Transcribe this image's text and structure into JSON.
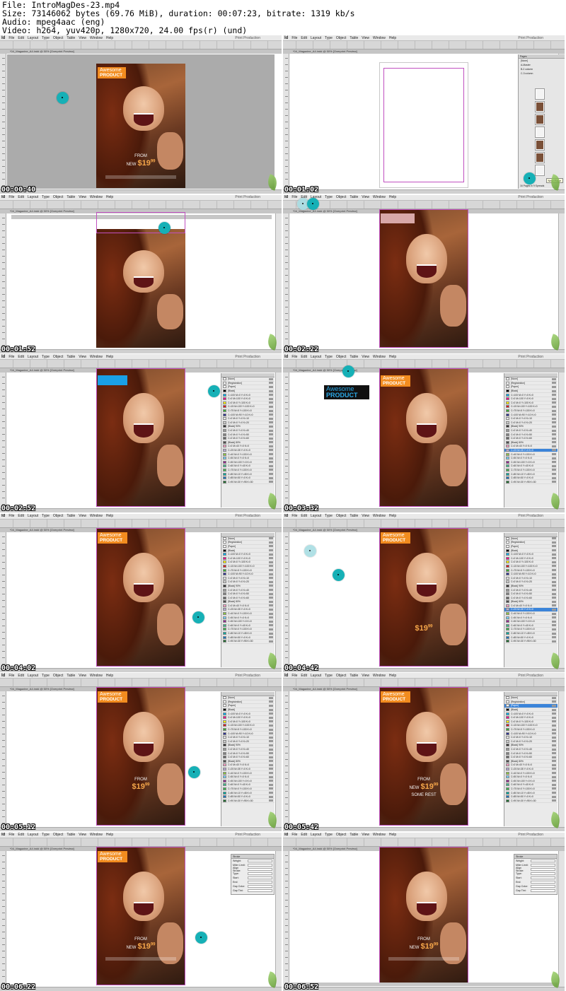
{
  "header": {
    "file_line": "File: IntroMagDes-23.mp4",
    "size_line": "Size: 73146062 bytes (69.76 MiB), duration: 00:07:23, bitrate: 1319 kb/s",
    "audio_line": "Audio: mpeg4aac (eng)",
    "video_line": "Video: h264, yuv420p, 1280x720, 24.00 fps(r) (und)"
  },
  "app": {
    "logo": "Id",
    "menus": [
      "File",
      "Edit",
      "Layout",
      "Type",
      "Object",
      "Table",
      "View",
      "Window",
      "Help"
    ],
    "workspace": "Print Production",
    "doc_tab": "*04_Magazine_A4.indd @ 50% [Overprint Preview]"
  },
  "cover": {
    "tag_line1": "Awesome",
    "tag_line2": "PRODUCT",
    "from": "FROM",
    "new": "NEW",
    "price": "$19",
    "cents": "99",
    "some_rest": "SOME REST"
  },
  "swatches": [
    "[None]",
    "[Registration]",
    "[Paper]",
    "[Black]",
    "C=100 M=0 Y=0 K=0",
    "C=0 M=100 Y=0 K=0",
    "C=0 M=0 Y=100 K=0",
    "C=15 M=100 Y=100 K=0",
    "C=75 M=5 Y=100 K=0",
    "C=100 M=90 Y=10 K=0",
    "C=0 M=0 Y=0 K=10",
    "C=0 M=0 Y=0 K=20",
    "[Black] 90%",
    "C=0 M=0 Y=0 K=40",
    "C=0 M=0 Y=0 K=50",
    "C=0 M=0 Y=0 K=60",
    "[Black] 80%",
    "C=0 M=40 Y=0 K=0",
    "C=25 M=35 Y=0 K=0",
    "C=40 M=0 Y=100 K=0",
    "C=50 M=0 Y=0 K=0",
    "C=50 M=100 Y=0 K=0",
    "C=60 M=0 Y=40 K=0",
    "C=75 M=0 Y=100 K=0",
    "C=80 M=10 Y=45 K=0",
    "C=85 M=50 Y=0 K=0",
    "C=90 M=30 Y=95 K=30"
  ],
  "pages_panel": {
    "tabs": "Pages",
    "masters": [
      "[None]",
      "A-Master",
      "B-2 column",
      "C-3 column"
    ],
    "footer": "16 Pages in 9 Spreads",
    "tooltip": "New Page"
  },
  "stroke_panel": {
    "title": "Stroke",
    "rows": [
      "Weight:",
      "Miter Limit:",
      "Align Stroke:",
      "Type:",
      "Start:",
      "End:",
      "Gap Color:",
      "Gap Tint:"
    ]
  },
  "timestamps": [
    "00:00:40",
    "00:01:02",
    "00:01:52",
    "00:02:22",
    "00:02:52",
    "00:03:32",
    "00:04:02",
    "00:04:42",
    "00:05:12",
    "00:05:42",
    "00:06:22",
    "00:06:52"
  ],
  "colors": {
    "orange_tag": "#f28c1f",
    "blue_box": "#1aa0e6",
    "cursor": "#16b0b6",
    "price": "#f5a64a"
  }
}
